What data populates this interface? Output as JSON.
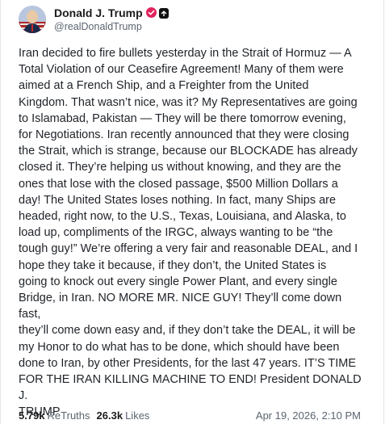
{
  "post": {
    "author": {
      "display_name": "Donald J. Trump",
      "handle": "@realDonaldTrump",
      "verified_icon": "verified-badge-icon",
      "extra_badge_icon": "square-badge-icon"
    },
    "text": "Iran decided to fire bullets yesterday in the Strait of Hormuz — A\nTotal Violation of our Ceasefire Agreement! Many of them were\naimed at a French Ship, and a Freighter from the United\nKingdom. That wasn’t nice, was it? My Representatives are going\nto Islamabad, Pakistan — They will be there tomorrow evening,\nfor Negotiations. Iran recently announced that they were closing\nthe Strait, which is strange, because our BLOCKADE has already\nclosed it. They’re helping us without knowing, and they are the\nones that lose with the closed passage, $500 Million Dollars a\nday! The United States loses nothing. In fact, many Ships are\nheaded, right now, to the U.S., Texas, Louisiana, and Alaska, to\nload up, compliments of the IRGC, always wanting to be “the\ntough guy!” We’re offering a very fair and reasonable DEAL, and I\nhope they take it because, if they don’t, the United States is\ngoing to knock out every single Power Plant, and every single\nBridge, in Iran. NO MORE MR. NICE GUY! They’ll come down fast,\nthey’ll come down easy and, if they don’t take the DEAL, it will be\nmy Honor to do what has to be done, which should have been\ndone to Iran, by other Presidents, for the last 47 years. IT’S TIME\nFOR THE IRAN KILLING MACHINE TO END! President DONALD J.\nTRUMP",
    "stats": {
      "retruths_count": "5.79k",
      "retruths_label": "ReTruths",
      "likes_count": "26.3k",
      "likes_label": "Likes"
    },
    "timestamp": "Apr 19, 2026, 2:10 PM"
  },
  "colors": {
    "verified": "#e0245e",
    "muted_text": "#5b6470"
  }
}
